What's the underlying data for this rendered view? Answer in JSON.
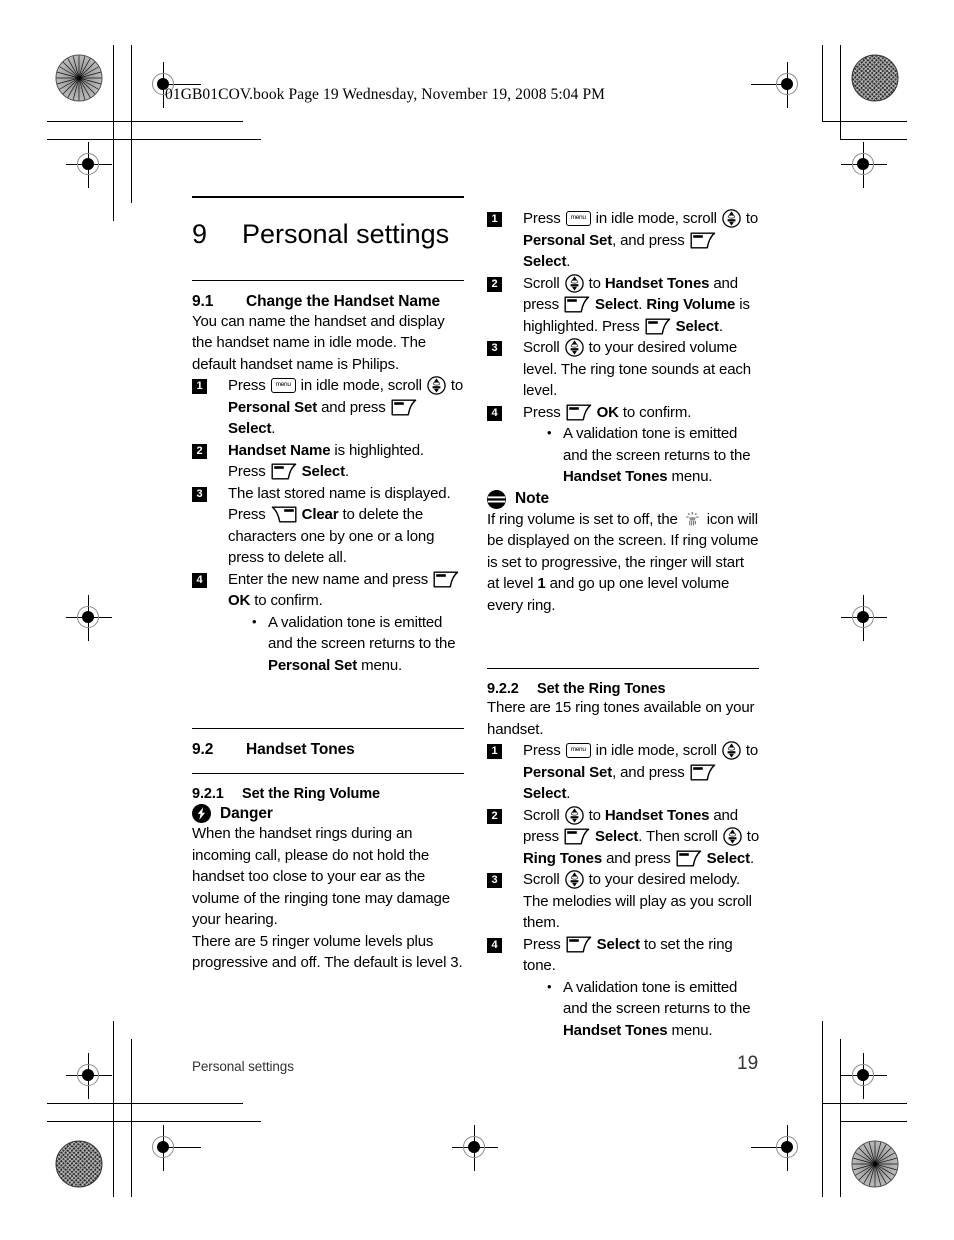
{
  "header": {
    "text": "01GB01COV.book  Page 19  Wednesday, November 19, 2008  5:04 PM"
  },
  "chapter": {
    "number": "9",
    "title": "Personal settings"
  },
  "sections": {
    "s91": {
      "number": "9.1",
      "title": "Change the Handset Name",
      "intro": "You can name the handset and display the handset name in idle mode. The default handset name is Philips.",
      "steps": [
        {
          "n": "1",
          "parts": [
            {
              "t": "text",
              "v": "Press "
            },
            {
              "t": "icon",
              "v": "menu-key-icon"
            },
            {
              "t": "text",
              "v": " in idle mode, scroll "
            },
            {
              "t": "icon",
              "v": "scroll-navigation-icon"
            },
            {
              "t": "text",
              "v": " to "
            },
            {
              "t": "bold",
              "v": "Personal Set"
            },
            {
              "t": "text",
              "v": " and press "
            },
            {
              "t": "icon",
              "v": "soft-key-right-icon"
            },
            {
              "t": "text",
              "v": " "
            },
            {
              "t": "bold",
              "v": "Select"
            },
            {
              "t": "text",
              "v": "."
            }
          ]
        },
        {
          "n": "2",
          "parts": [
            {
              "t": "bold",
              "v": "Handset Name"
            },
            {
              "t": "text",
              "v": " is highlighted. Press "
            },
            {
              "t": "icon",
              "v": "soft-key-right-icon"
            },
            {
              "t": "text",
              "v": " "
            },
            {
              "t": "bold",
              "v": "Select"
            },
            {
              "t": "text",
              "v": "."
            }
          ]
        },
        {
          "n": "3",
          "parts": [
            {
              "t": "text",
              "v": "The last stored name is displayed. Press "
            },
            {
              "t": "icon",
              "v": "soft-key-left-icon"
            },
            {
              "t": "text",
              "v": " "
            },
            {
              "t": "bold",
              "v": "Clear"
            },
            {
              "t": "text",
              "v": " to delete the characters one by one or a long press to delete all."
            }
          ]
        },
        {
          "n": "4",
          "parts": [
            {
              "t": "text",
              "v": "Enter the new name and press "
            },
            {
              "t": "icon",
              "v": "soft-key-right-icon"
            },
            {
              "t": "text",
              "v": " "
            },
            {
              "t": "bold",
              "v": "OK"
            },
            {
              "t": "text",
              "v": " to confirm."
            }
          ],
          "sub": [
            [
              {
                "t": "text",
                "v": "A validation tone is emitted and the screen returns to the "
              },
              {
                "t": "bold",
                "v": "Personal Set"
              },
              {
                "t": "text",
                "v": " menu."
              }
            ]
          ]
        }
      ]
    },
    "s92": {
      "number": "9.2",
      "title": "Handset Tones"
    },
    "s921": {
      "number": "9.2.1",
      "title": "Set the Ring Volume",
      "callout_icon": "danger-icon",
      "callout_title": "Danger",
      "callout_body": "When the handset rings during an incoming call, please do not hold the handset too close to your ear as the volume of the ringing tone may damage your hearing.",
      "body2": "There are 5 ringer volume levels plus progressive and off. The default is level 3.",
      "steps": [
        {
          "n": "1",
          "parts": [
            {
              "t": "text",
              "v": "Press "
            },
            {
              "t": "icon",
              "v": "menu-key-icon"
            },
            {
              "t": "text",
              "v": " in idle mode, scroll "
            },
            {
              "t": "icon",
              "v": "scroll-navigation-icon"
            },
            {
              "t": "text",
              "v": " to "
            },
            {
              "t": "bold",
              "v": "Personal Set"
            },
            {
              "t": "text",
              "v": ", and press "
            },
            {
              "t": "icon",
              "v": "soft-key-right-icon"
            },
            {
              "t": "text",
              "v": " "
            },
            {
              "t": "bold",
              "v": "Select"
            },
            {
              "t": "text",
              "v": "."
            }
          ]
        },
        {
          "n": "2",
          "parts": [
            {
              "t": "text",
              "v": "Scroll "
            },
            {
              "t": "icon",
              "v": "scroll-navigation-icon"
            },
            {
              "t": "text",
              "v": " to "
            },
            {
              "t": "bold",
              "v": "Handset Tones"
            },
            {
              "t": "text",
              "v": " and press "
            },
            {
              "t": "icon",
              "v": "soft-key-right-icon"
            },
            {
              "t": "text",
              "v": " "
            },
            {
              "t": "bold",
              "v": "Select"
            },
            {
              "t": "text",
              "v": ". "
            },
            {
              "t": "bold",
              "v": "Ring Volume"
            },
            {
              "t": "text",
              "v": " is highlighted. Press "
            },
            {
              "t": "icon",
              "v": "soft-key-right-icon"
            },
            {
              "t": "text",
              "v": " "
            },
            {
              "t": "bold",
              "v": "Select"
            },
            {
              "t": "text",
              "v": "."
            }
          ]
        },
        {
          "n": "3",
          "parts": [
            {
              "t": "text",
              "v": "Scroll "
            },
            {
              "t": "icon",
              "v": "scroll-navigation-icon"
            },
            {
              "t": "text",
              "v": " to your desired volume level. The ring tone sounds at each level."
            }
          ]
        },
        {
          "n": "4",
          "parts": [
            {
              "t": "text",
              "v": "Press "
            },
            {
              "t": "icon",
              "v": "soft-key-right-icon"
            },
            {
              "t": "text",
              "v": " "
            },
            {
              "t": "bold",
              "v": "OK"
            },
            {
              "t": "text",
              "v": " to confirm."
            }
          ],
          "sub": [
            [
              {
                "t": "text",
                "v": "A validation tone is emitted and the screen returns to the "
              },
              {
                "t": "bold",
                "v": "Handset Tones"
              },
              {
                "t": "text",
                "v": " menu."
              }
            ]
          ]
        }
      ],
      "note_icon": "note-icon",
      "note_title": "Note",
      "note_parts": [
        {
          "t": "text",
          "v": "If ring volume is set to off, the "
        },
        {
          "t": "icon",
          "v": "ringer-off-icon"
        },
        {
          "t": "text",
          "v": " icon will be displayed on the screen. If ring volume is set to progressive, the ringer will start at level "
        },
        {
          "t": "bold",
          "v": "1"
        },
        {
          "t": "text",
          "v": " and go up one level volume every ring."
        }
      ]
    },
    "s922": {
      "number": "9.2.2",
      "title": "Set the Ring Tones",
      "intro": "There are 15 ring tones available on your handset.",
      "steps": [
        {
          "n": "1",
          "parts": [
            {
              "t": "text",
              "v": "Press "
            },
            {
              "t": "icon",
              "v": "menu-key-icon"
            },
            {
              "t": "text",
              "v": " in idle mode, scroll "
            },
            {
              "t": "icon",
              "v": "scroll-navigation-icon"
            },
            {
              "t": "text",
              "v": " to "
            },
            {
              "t": "bold",
              "v": "Personal Set"
            },
            {
              "t": "text",
              "v": ", and press "
            },
            {
              "t": "icon",
              "v": "soft-key-right-icon"
            },
            {
              "t": "text",
              "v": " "
            },
            {
              "t": "bold",
              "v": "Select"
            },
            {
              "t": "text",
              "v": "."
            }
          ]
        },
        {
          "n": "2",
          "parts": [
            {
              "t": "text",
              "v": "Scroll "
            },
            {
              "t": "icon",
              "v": "scroll-navigation-icon"
            },
            {
              "t": "text",
              "v": " to "
            },
            {
              "t": "bold",
              "v": "Handset Tones"
            },
            {
              "t": "text",
              "v": " and press "
            },
            {
              "t": "icon",
              "v": "soft-key-right-icon"
            },
            {
              "t": "text",
              "v": " "
            },
            {
              "t": "bold",
              "v": "Select"
            },
            {
              "t": "text",
              "v": ". Then scroll "
            },
            {
              "t": "icon",
              "v": "scroll-navigation-icon"
            },
            {
              "t": "text",
              "v": " to "
            },
            {
              "t": "bold",
              "v": "Ring Tones"
            },
            {
              "t": "text",
              "v": " and press "
            },
            {
              "t": "icon",
              "v": "soft-key-right-icon"
            },
            {
              "t": "text",
              "v": " "
            },
            {
              "t": "bold",
              "v": "Select"
            },
            {
              "t": "text",
              "v": "."
            }
          ]
        },
        {
          "n": "3",
          "parts": [
            {
              "t": "text",
              "v": "Scroll "
            },
            {
              "t": "icon",
              "v": "scroll-navigation-icon"
            },
            {
              "t": "text",
              "v": " to your desired melody. The melodies will play as you scroll them."
            }
          ]
        },
        {
          "n": "4",
          "parts": [
            {
              "t": "text",
              "v": "Press "
            },
            {
              "t": "icon",
              "v": "soft-key-right-icon"
            },
            {
              "t": "text",
              "v": " "
            },
            {
              "t": "bold",
              "v": "Select"
            },
            {
              "t": "text",
              "v": " to set the ring tone."
            }
          ],
          "sub": [
            [
              {
                "t": "text",
                "v": "A validation tone is emitted and the screen returns to the "
              },
              {
                "t": "bold",
                "v": "Handset Tones"
              },
              {
                "t": "text",
                "v": " menu."
              }
            ]
          ]
        }
      ]
    }
  },
  "footer": {
    "left": "Personal settings",
    "page": "19"
  },
  "colors": {
    "text": "#000000",
    "footer_text": "#333333",
    "rule": "#000000",
    "reg_ring": "#8a8a8a"
  }
}
